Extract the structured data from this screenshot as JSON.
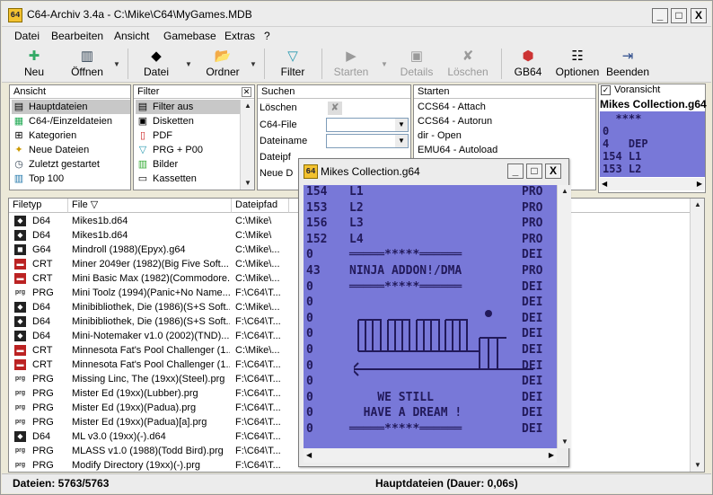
{
  "window": {
    "title": "C64-Archiv 3.4a - C:\\Mike\\C64\\MyGames.MDB",
    "minimize": "_",
    "maximize": "□",
    "close": "X"
  },
  "menu": [
    "Datei",
    "Bearbeiten",
    "Ansicht",
    "Gamebase",
    "Extras",
    "?"
  ],
  "toolbar": {
    "neu": "Neu",
    "oeffnen": "Öffnen",
    "datei": "Datei",
    "ordner": "Ordner",
    "filter": "Filter",
    "starten": "Starten",
    "details": "Details",
    "loeschen": "Löschen",
    "gb64": "GB64",
    "optionen": "Optionen",
    "beenden": "Beenden"
  },
  "ansicht": {
    "header": "Ansicht",
    "items": [
      {
        "label": "Hauptdateien",
        "icon": "list-icon"
      },
      {
        "label": "C64-/Einzeldateien",
        "icon": "grid-icon"
      },
      {
        "label": "Kategorien",
        "icon": "tree-icon"
      },
      {
        "label": "Neue Dateien",
        "icon": "new-file-icon"
      },
      {
        "label": "Zuletzt gestartet",
        "icon": "clock-icon"
      },
      {
        "label": "Top 100",
        "icon": "chart-icon"
      }
    ]
  },
  "filter": {
    "header": "Filter",
    "items": [
      {
        "label": "Filter aus",
        "icon": "filter-off-icon"
      },
      {
        "label": "Disketten",
        "icon": "disk-icon"
      },
      {
        "label": "PDF",
        "icon": "pdf-icon"
      },
      {
        "label": "PRG + P00",
        "icon": "funnel-icon"
      },
      {
        "label": "Bilder",
        "icon": "image-icon"
      },
      {
        "label": "Kassetten",
        "icon": "tape-icon"
      }
    ]
  },
  "suchen": {
    "header": "Suchen",
    "loeschen": "Löschen",
    "c64file": "C64-File",
    "dateiname": "Dateiname",
    "dateipfad": "Dateipf",
    "neue": "Neue D"
  },
  "starten": {
    "header": "Starten",
    "items": [
      "CCS64 - Attach",
      "CCS64 - Autorun",
      "dir - Open",
      "EMU64 - Autoload"
    ]
  },
  "preview": {
    "checkbox_label": "Voransicht",
    "checked": true,
    "title": "Mikes Collection.g64",
    "lines": [
      "  ****",
      "0",
      "4   DEP",
      "154 L1",
      "153 L2"
    ]
  },
  "grid": {
    "columns": [
      "Filetyp",
      "File ▽",
      "Dateipfad",
      ""
    ],
    "rows": [
      {
        "type": "D64",
        "file": "Mikes1b.d64",
        "path": "C:\\Mike\\"
      },
      {
        "type": "D64",
        "file": "Mikes1b.d64",
        "path": "C:\\Mike\\"
      },
      {
        "type": "G64",
        "file": "Mindroll (1988)(Epyx).g64",
        "path": "C:\\Mike\\..."
      },
      {
        "type": "CRT",
        "file": "Miner 2049er (1982)(Big Five Soft...",
        "path": "C:\\Mike\\..."
      },
      {
        "type": "CRT",
        "file": "Mini Basic Max (1982)(Commodore...",
        "path": "C:\\Mike\\..."
      },
      {
        "type": "PRG",
        "file": "Mini Toolz (1994)(Panic+No Name...",
        "path": "F:\\C64\\T..."
      },
      {
        "type": "D64",
        "file": "Minibibliothek, Die (1986)(S+S Soft...",
        "path": "C:\\Mike\\..."
      },
      {
        "type": "D64",
        "file": "Minibibliothek, Die (1986)(S+S Soft...",
        "path": "F:\\C64\\T..."
      },
      {
        "type": "D64",
        "file": "Mini-Notemaker v1.0 (2002)(TND)....",
        "path": "F:\\C64\\T..."
      },
      {
        "type": "CRT",
        "file": "Minnesota Fat's Pool Challenger (1...",
        "path": "C:\\Mike\\..."
      },
      {
        "type": "CRT",
        "file": "Minnesota Fat's Pool Challenger (1...",
        "path": "F:\\C64\\T..."
      },
      {
        "type": "PRG",
        "file": "Missing Linc, The (19xx)(Steel).prg",
        "path": "F:\\C64\\T..."
      },
      {
        "type": "PRG",
        "file": "Mister Ed (19xx)(Lubber).prg",
        "path": "F:\\C64\\T..."
      },
      {
        "type": "PRG",
        "file": "Mister Ed (19xx)(Padua).prg",
        "path": "F:\\C64\\T..."
      },
      {
        "type": "PRG",
        "file": "Mister Ed (19xx)(Padua)[a].prg",
        "path": "F:\\C64\\T..."
      },
      {
        "type": "D64",
        "file": "ML v3.0 (19xx)(-).d64",
        "path": "F:\\C64\\T..."
      },
      {
        "type": "PRG",
        "file": "MLASS v1.0 (1988)(Todd Bird).prg",
        "path": "F:\\C64\\T..."
      },
      {
        "type": "PRG",
        "file": "Modify Directory (19xx)(-).prg",
        "path": "F:\\C64\\T..."
      }
    ]
  },
  "popup": {
    "title": "Mikes Collection.g64",
    "lines": [
      {
        "blocks": "154",
        "name": "L1",
        "ftype": "PRO"
      },
      {
        "blocks": "153",
        "name": "L2",
        "ftype": "PRO"
      },
      {
        "blocks": "156",
        "name": "L3",
        "ftype": "PRO"
      },
      {
        "blocks": "152",
        "name": "L4",
        "ftype": "PRO"
      },
      {
        "blocks": "0",
        "name": "═════*****══════",
        "ftype": "DEI"
      },
      {
        "blocks": "43",
        "name": "NINJA ADDON!/DMA",
        "ftype": "PRO"
      },
      {
        "blocks": "0",
        "name": "═════*****══════",
        "ftype": "DEI"
      },
      {
        "blocks": "0",
        "name": "",
        "ftype": "DEI"
      },
      {
        "blocks": "0",
        "name": "",
        "ftype": "DEI"
      },
      {
        "blocks": "0",
        "name": "",
        "ftype": "DEI"
      },
      {
        "blocks": "0",
        "name": "",
        "ftype": "DEI"
      },
      {
        "blocks": "0",
        "name": "",
        "ftype": "DEI"
      },
      {
        "blocks": "0",
        "name": "",
        "ftype": "DEI"
      },
      {
        "blocks": "0",
        "name": "    WE STILL",
        "ftype": "DEI"
      },
      {
        "blocks": "0",
        "name": "  HAVE A DREAM !",
        "ftype": "DEI"
      },
      {
        "blocks": "0",
        "name": "═════*****══════",
        "ftype": "DEI"
      }
    ]
  },
  "status": {
    "files": "Dateien: 5763/5763",
    "view": "Hauptdateien (Dauer: 0,06s)"
  },
  "colors": {
    "c64_bg": "#7878d8",
    "c64_fg": "#221a5a",
    "selection": "#c8c8c8"
  }
}
